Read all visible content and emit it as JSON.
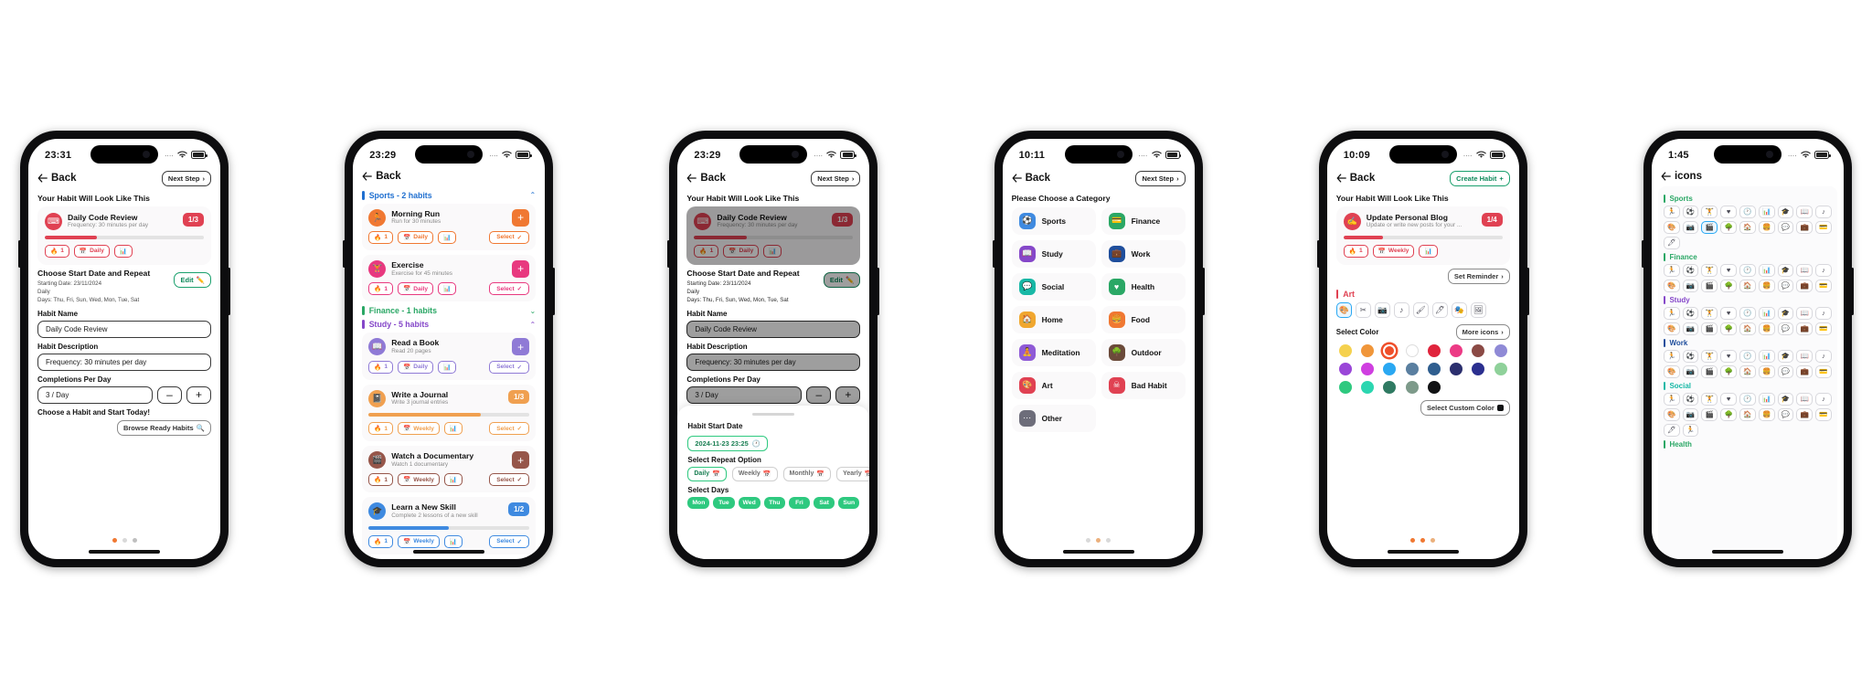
{
  "phones": [
    {
      "id": "phone-preview-habit",
      "status": {
        "time": "23:31",
        "dots": "....",
        "wifi": "wifi-icon",
        "battery": "battery-icon"
      },
      "nav": {
        "back": "Back",
        "action": "Next Step",
        "action_icon": "chevron-right-icon"
      },
      "section_title": "Your Habit Will Look Like This",
      "preview": {
        "icon": "code-icon",
        "name": "Daily Code Review",
        "desc": "Frequency: 30 minutes per day",
        "fraction": "1/3",
        "progress": 33,
        "color": "#e04152",
        "chips": [
          {
            "label": "1",
            "icon": "flame-icon"
          },
          {
            "label": "Daily",
            "icon": "calendar-icon"
          },
          {
            "label": "",
            "icon": "chart-icon"
          }
        ]
      },
      "repeat": {
        "title": "Choose Start Date and Repeat",
        "starting": "Starting Date: 23/11/2024",
        "frequency": "Daily",
        "days": "Days: Thu, Fri, Sun, Wed, Mon, Tue, Sat",
        "edit_label": "Edit",
        "edit_icon": "pencil-icon"
      },
      "form": {
        "name_label": "Habit Name",
        "name_value": "Daily Code Review",
        "desc_label": "Habit Description",
        "desc_value": "Frequency: 30 minutes per day",
        "count_label": "Completions Per Day",
        "count_value": "3 / Day",
        "minus": "–",
        "plus": "+"
      },
      "cta": {
        "title": "Choose a Habit and Start Today!",
        "button": "Browse Ready Habits",
        "button_icon": "search-icon"
      },
      "dots": [
        "#f07832",
        "#d9d9d9",
        "#bfbfbf"
      ]
    },
    {
      "id": "phone-ready-habits",
      "status": {
        "time": "23:29",
        "dots": "....",
        "wifi": "wifi-icon",
        "battery": "battery-icon"
      },
      "nav": {
        "back": "Back"
      },
      "groups": [
        {
          "title": "Sports - 2 habits",
          "color": "#1f6fd0",
          "chevron": "chevron-up-icon",
          "habits": [
            {
              "icon": "run-icon",
              "name": "Morning Run",
              "desc": "Run for 30 minutes",
              "color": "#f07832",
              "add": "+",
              "select": "Select",
              "select_icon": "check-icon",
              "chips": [
                {
                  "label": "1",
                  "icon": "flame-icon"
                },
                {
                  "label": "Daily",
                  "icon": "calendar-icon"
                },
                {
                  "label": "",
                  "icon": "chart-icon"
                }
              ]
            },
            {
              "icon": "dumbbell-icon",
              "name": "Exercise",
              "desc": "Exercise for 45 minutes",
              "color": "#e8397f",
              "add": "+",
              "select": "Select",
              "select_icon": "check-icon",
              "chips": [
                {
                  "label": "1",
                  "icon": "flame-icon"
                },
                {
                  "label": "Daily",
                  "icon": "calendar-icon"
                },
                {
                  "label": "",
                  "icon": "chart-icon"
                }
              ]
            }
          ]
        },
        {
          "title": "Finance - 1 habits",
          "color": "#2aa765",
          "chevron": "chevron-down-icon",
          "habits": []
        },
        {
          "title": "Study - 5 habits",
          "color": "#8547c9",
          "chevron": "chevron-up-icon",
          "habits": [
            {
              "icon": "book-icon",
              "name": "Read a Book",
              "desc": "Read 20 pages",
              "color": "#8f7ad6",
              "add": "+",
              "select": "Select",
              "select_icon": "check-icon",
              "chips": [
                {
                  "label": "1",
                  "icon": "flame-icon"
                },
                {
                  "label": "Daily",
                  "icon": "calendar-icon"
                },
                {
                  "label": "",
                  "icon": "chart-icon"
                }
              ]
            },
            {
              "icon": "journal-icon",
              "name": "Write a Journal",
              "desc": "Write 3 journal entries",
              "color": "#f0a050",
              "fraction": "1/3",
              "progress": 70,
              "select": "Select",
              "select_icon": "check-icon",
              "chips": [
                {
                  "label": "1",
                  "icon": "flame-icon"
                },
                {
                  "label": "Weekly",
                  "icon": "calendar-icon"
                },
                {
                  "label": "",
                  "icon": "chart-icon"
                }
              ]
            },
            {
              "icon": "film-icon",
              "name": "Watch a Documentary",
              "desc": "Watch 1 documentary",
              "color": "#96564a",
              "add": "+",
              "select": "Select",
              "select_icon": "check-icon",
              "chips": [
                {
                  "label": "1",
                  "icon": "flame-icon"
                },
                {
                  "label": "Weekly",
                  "icon": "calendar-icon"
                },
                {
                  "label": "",
                  "icon": "chart-icon"
                }
              ]
            },
            {
              "icon": "skill-icon",
              "name": "Learn a New Skill",
              "desc": "Complete 2 lessons of a new skill",
              "color": "#3f8ae0",
              "fraction": "1/2",
              "progress": 50,
              "select": "Select",
              "select_icon": "check-icon",
              "chips": [
                {
                  "label": "1",
                  "icon": "flame-icon"
                },
                {
                  "label": "Weekly",
                  "icon": "calendar-icon"
                },
                {
                  "label": "",
                  "icon": "chart-icon"
                }
              ]
            }
          ]
        }
      ]
    },
    {
      "id": "phone-start-date-modal",
      "status": {
        "time": "23:29",
        "dots": "....",
        "wifi": "wifi-icon",
        "battery": "battery-icon"
      },
      "nav": {
        "back": "Back",
        "action": "Next Step",
        "action_icon": "chevron-right-icon"
      },
      "section_title": "Your Habit Will Look Like This",
      "preview": {
        "icon": "code-icon",
        "name": "Daily Code Review",
        "desc": "Frequency: 30 minutes per day",
        "fraction": "1/3",
        "progress": 33,
        "color": "#e04152",
        "chips": [
          {
            "label": "1",
            "icon": "flame-icon"
          },
          {
            "label": "Daily",
            "icon": "calendar-icon"
          },
          {
            "label": "",
            "icon": "chart-icon"
          }
        ]
      },
      "repeat": {
        "title": "Choose Start Date and Repeat",
        "starting": "Starting Date: 23/11/2024",
        "frequency": "Daily",
        "days": "Days: Thu, Fri, Sun, Wed, Mon, Tue, Sat",
        "edit_label": "Edit",
        "edit_icon": "pencil-icon"
      },
      "form": {
        "name_label": "Habit Name",
        "name_value": "Daily Code Review",
        "desc_label": "Habit Description",
        "desc_value": "Frequency: 30 minutes per day",
        "count_label": "Completions Per Day",
        "count_value": "3 / Day",
        "minus": "–",
        "plus": "+"
      },
      "cta": {
        "title": "Choose a Habit and Start Today!"
      },
      "sheet": {
        "start_label": "Habit Start Date",
        "start_value": "2024-11-23 23:25",
        "start_icon": "clock-icon",
        "repeat_label": "Select Repeat Option",
        "repeat_options": [
          {
            "label": "Daily",
            "icon": "calendar-icon",
            "active": true
          },
          {
            "label": "Weekly",
            "icon": "calendar-icon",
            "active": false
          },
          {
            "label": "Monthly",
            "icon": "calendar-icon",
            "active": false
          },
          {
            "label": "Yearly",
            "icon": "calendar-icon",
            "active": false
          }
        ],
        "days_label": "Select Days",
        "days": [
          "Mon",
          "Tue",
          "Wed",
          "Thu",
          "Fri",
          "Sat",
          "Sun"
        ]
      }
    },
    {
      "id": "phone-choose-category",
      "status": {
        "time": "10:11",
        "dots": "....",
        "wifi": "wifi-icon",
        "battery": "battery-icon"
      },
      "nav": {
        "back": "Back",
        "action": "Next Step",
        "action_icon": "chevron-right-icon"
      },
      "section_title": "Please Choose a Category",
      "categories": [
        {
          "label": "Sports",
          "icon": "ball-icon",
          "color": "#3f8ae0"
        },
        {
          "label": "Finance",
          "icon": "wallet-icon",
          "color": "#2aa765"
        },
        {
          "label": "Study",
          "icon": "book-icon",
          "color": "#8547c9"
        },
        {
          "label": "Work",
          "icon": "briefcase-icon",
          "color": "#1f4e9c"
        },
        {
          "label": "Social",
          "icon": "chat-icon",
          "color": "#18b8a6"
        },
        {
          "label": "Health",
          "icon": "heart-icon",
          "color": "#2aa765"
        },
        {
          "label": "Home",
          "icon": "house-icon",
          "color": "#f0a72f"
        },
        {
          "label": "Food",
          "icon": "food-icon",
          "color": "#f07832"
        },
        {
          "label": "Meditation",
          "icon": "lotus-icon",
          "color": "#8f5ad6"
        },
        {
          "label": "Outdoor",
          "icon": "tree-icon",
          "color": "#6b4a3a"
        },
        {
          "label": "Art",
          "icon": "palette-icon",
          "color": "#e04152"
        },
        {
          "label": "Bad Habit",
          "icon": "skull-icon",
          "color": "#e04152"
        },
        {
          "label": "Other",
          "icon": "dots-icon",
          "color": "#6d6d7a"
        }
      ],
      "dots": [
        "#d9d9d9",
        "#ebb07c",
        "#d9d9d9"
      ]
    },
    {
      "id": "phone-color-picker",
      "status": {
        "time": "10:09",
        "dots": "....",
        "wifi": "wifi-icon",
        "battery": "battery-icon"
      },
      "nav": {
        "back": "Back",
        "action": "Create Habit",
        "action_icon": "plus-icon"
      },
      "section_title": "Your Habit Will Look Like This",
      "preview": {
        "icon": "blog-icon",
        "name": "Update Personal Blog",
        "desc": "Update or write new posts for your ...",
        "fraction": "1/4",
        "progress": 25,
        "color": "#e04152",
        "chips": [
          {
            "label": "1",
            "icon": "flame-icon"
          },
          {
            "label": "Weekly",
            "icon": "calendar-icon"
          },
          {
            "label": "",
            "icon": "chart-icon"
          }
        ]
      },
      "reminder_button": "Set Reminder",
      "reminder_icon": "chevron-right-icon",
      "art_group": {
        "label": "Art",
        "color": "#e04152"
      },
      "art_icons": [
        "palette-icon",
        "scissors-icon",
        "camera-icon",
        "music-icon",
        "brush-icon",
        "pen-icon",
        "theater-icon",
        "frame-icon"
      ],
      "select_color_label": "Select Color",
      "more_icons_button": "More icons",
      "more_icons_icon": "chevron-right-icon",
      "colors": [
        "#f5d14e",
        "#f0963a",
        "#ef4f2a",
        "#ffffff",
        "#e0243c",
        "#ec3a85",
        "#8b4a45",
        "#8f8ad6",
        "#9a46d8",
        "#cf3fe0",
        "#2aa8f2",
        "#5a7fa0",
        "#2f5e8f",
        "#2b2f6e",
        "#2b2f8f",
        "#8fd19a",
        "#2ec97f",
        "#2bd6b0",
        "#2f7a62",
        "#7d9a8a",
        "#111214"
      ],
      "selected_color": "#ef4f2a",
      "custom_color_button": "Select Custom Color",
      "dots": [
        "#f07832",
        "#f07832",
        "#ebb07c"
      ]
    },
    {
      "id": "phone-icon-library",
      "status": {
        "time": "1:45",
        "dots": "....",
        "wifi": "wifi-icon",
        "battery": "battery-icon"
      },
      "nav": {
        "back": "icons"
      },
      "icon_groups": [
        {
          "title": "Sports",
          "color": "#2aa765",
          "count": 19,
          "active_index": 11
        },
        {
          "title": "Finance",
          "color": "#2aa765",
          "count": 18
        },
        {
          "title": "Study",
          "color": "#8547c9",
          "count": 18
        },
        {
          "title": "Work",
          "color": "#1f4e9c",
          "count": 18
        },
        {
          "title": "Social",
          "color": "#18b8a6",
          "count": 20
        },
        {
          "title": "Health",
          "color": "#2aa765",
          "count": 0
        }
      ]
    }
  ]
}
